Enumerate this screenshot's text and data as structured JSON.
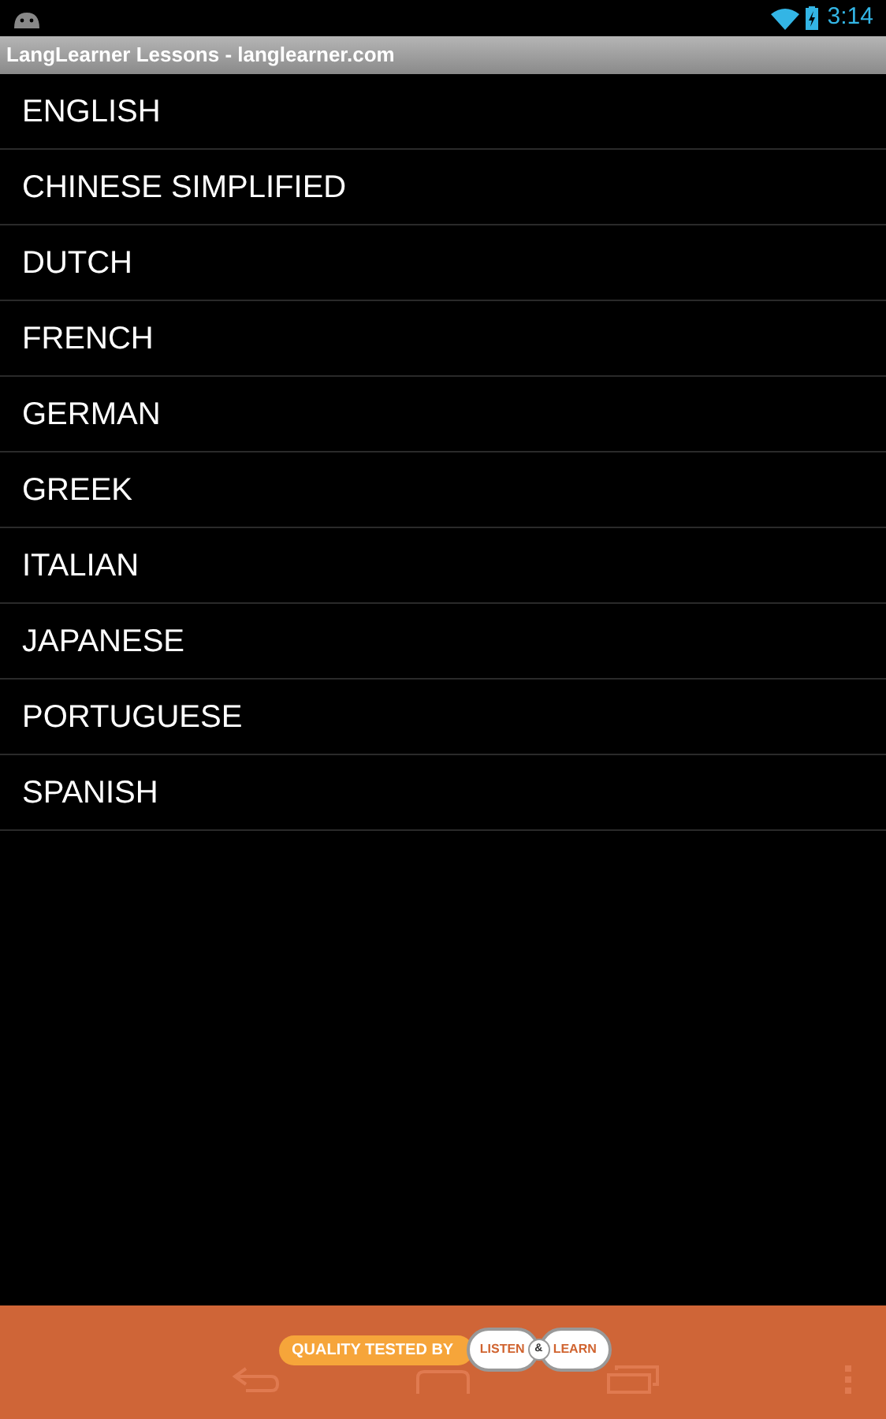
{
  "status_bar": {
    "time": "3:14"
  },
  "window": {
    "title": "LangLearner Lessons - langlearner.com"
  },
  "languages": [
    {
      "label": "ENGLISH"
    },
    {
      "label": "CHINESE SIMPLIFIED"
    },
    {
      "label": "DUTCH"
    },
    {
      "label": "FRENCH"
    },
    {
      "label": "GERMAN"
    },
    {
      "label": "GREEK"
    },
    {
      "label": "ITALIAN"
    },
    {
      "label": "JAPANESE"
    },
    {
      "label": "PORTUGUESE"
    },
    {
      "label": "SPANISH"
    }
  ],
  "banner": {
    "tagline": "QUALITY TESTED BY",
    "logo_left": "LISTEN",
    "logo_mid": "&",
    "logo_right": "LEARN"
  }
}
